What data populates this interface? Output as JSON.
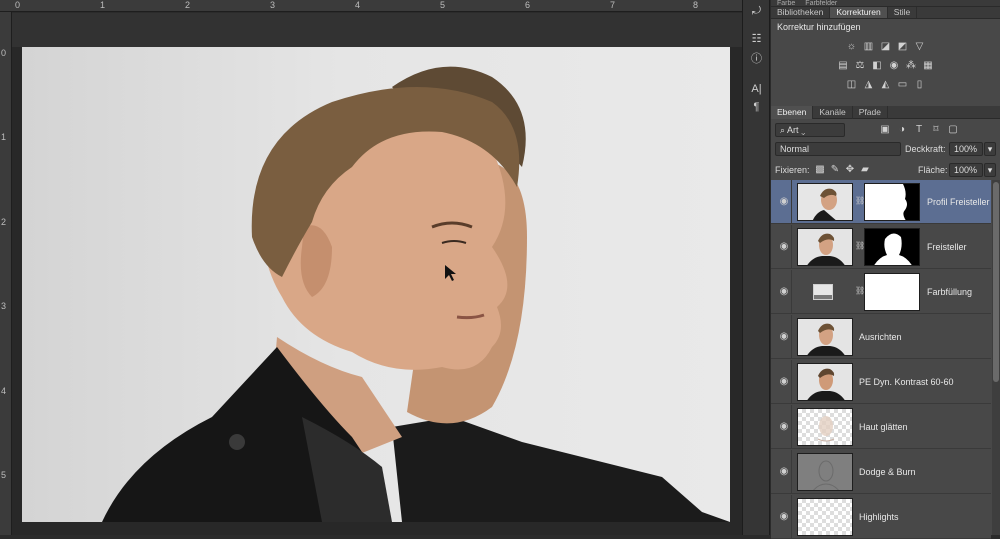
{
  "ruler": {
    "top_numbers": [
      "0",
      "1",
      "2",
      "3",
      "4",
      "5",
      "6",
      "7",
      "8"
    ],
    "left_numbers": [
      "0",
      "1",
      "2",
      "3",
      "4",
      "5"
    ]
  },
  "side_toolbar": {
    "icons": [
      "history-icon",
      "properties-icon",
      "info-icon",
      "character-icon",
      "paragraph-icon"
    ]
  },
  "panels": {
    "top_tabs": [
      "Farbe",
      "Farbfelder"
    ],
    "tabs": [
      "Bibliotheken",
      "Korrekturen",
      "Stile"
    ],
    "active_tab": "Korrekturen",
    "korrektur_title": "Korrektur hinzufügen",
    "adjust_icons_row1": [
      "brightness-icon",
      "levels-icon",
      "curves-icon",
      "exposure-icon",
      "triangle-icon"
    ],
    "adjust_icons_row2": [
      "vibrance-icon",
      "balance-icon",
      "bw-icon",
      "photo-filter-icon",
      "channel-mixer-icon",
      "lookup-icon"
    ],
    "adjust_icons_row3": [
      "invert-icon",
      "posterize-icon",
      "threshold-icon",
      "gradient-map-icon",
      "selective-color-icon"
    ]
  },
  "layers_panel": {
    "tabs": [
      "Ebenen",
      "Kanäle",
      "Pfade"
    ],
    "active_tab": "Ebenen",
    "filter_value": "Art",
    "blend_mode": "Normal",
    "opacity_label": "Deckkraft:",
    "opacity_value": "100%",
    "lock_label": "Fixieren:",
    "fill_label": "Fläche:",
    "fill_value": "100%",
    "layers": [
      {
        "name": "Profil Freisteller",
        "selected": true,
        "has_mask": true
      },
      {
        "name": "Freisteller",
        "selected": false,
        "has_mask": true
      },
      {
        "name": "Farbfüllung",
        "selected": false,
        "has_mask": true
      },
      {
        "name": "Ausrichten",
        "selected": false,
        "has_mask": false
      },
      {
        "name": "PE Dyn. Kontrast 60-60",
        "selected": false,
        "has_mask": false
      },
      {
        "name": "Haut glätten",
        "selected": false,
        "has_mask": false
      },
      {
        "name": "Dodge & Burn",
        "selected": false,
        "has_mask": false
      },
      {
        "name": "Highlights",
        "selected": false,
        "has_mask": false
      }
    ]
  },
  "colors": {
    "selected_layer": "#5c6e92",
    "panel_bg": "#484848",
    "canvas_bg": "#282828"
  }
}
